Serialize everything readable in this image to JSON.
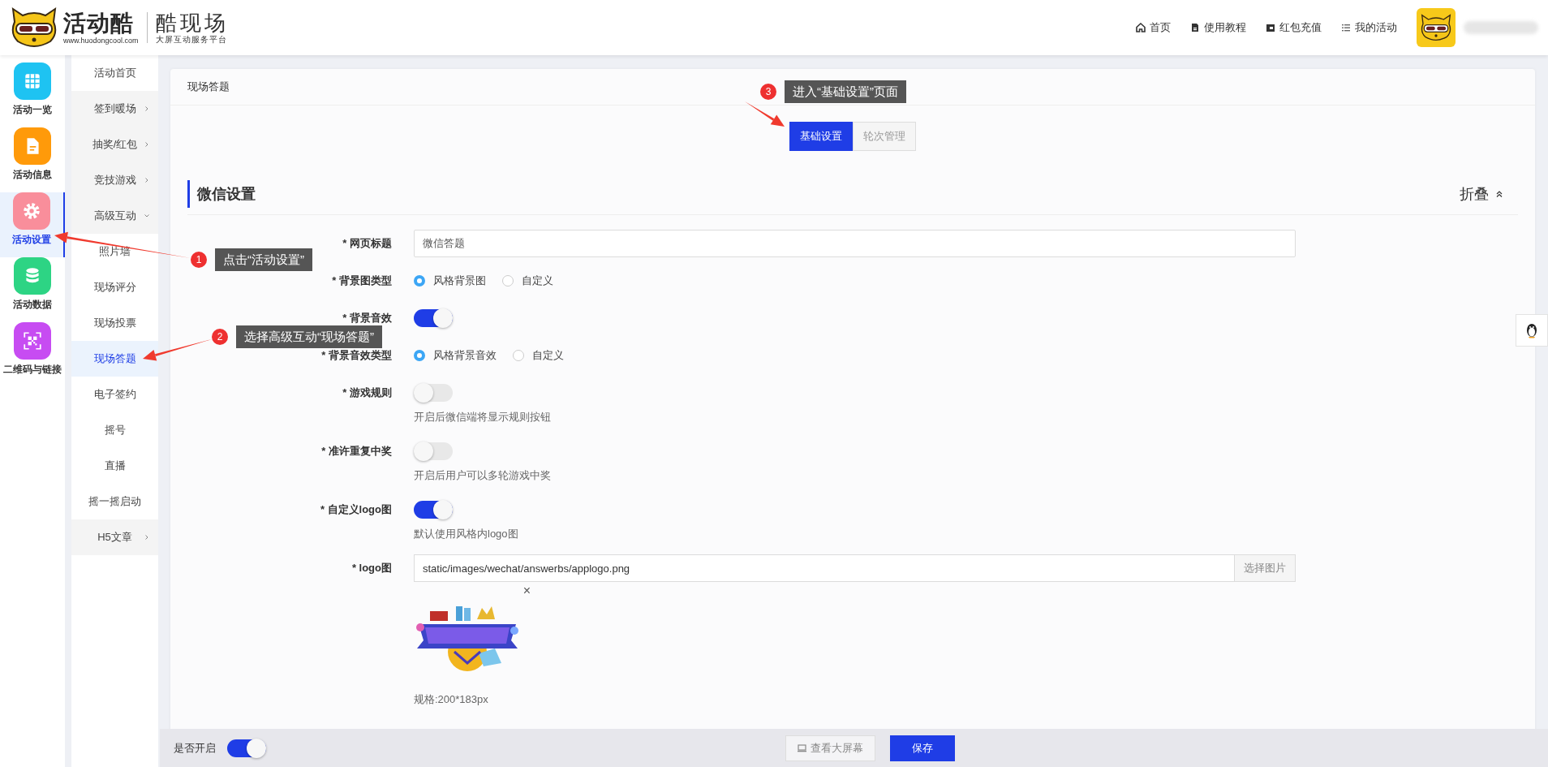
{
  "header": {
    "logo": {
      "brand": "活动酷",
      "url": "www.huodongcool.com",
      "product": "酷现场",
      "slogan": "大屏互动服务平台"
    },
    "nav": [
      {
        "label": "首页"
      },
      {
        "label": "使用教程"
      },
      {
        "label": "红包充值"
      },
      {
        "label": "我的活动"
      }
    ]
  },
  "modules": [
    {
      "label": "活动一览",
      "color": "#1ec3f2",
      "selected": false
    },
    {
      "label": "活动信息",
      "color": "#ff9a0a",
      "selected": false
    },
    {
      "label": "活动设置",
      "color": "#f98e9b",
      "selected": true
    },
    {
      "label": "活动数据",
      "color": "#2dd484",
      "selected": false
    },
    {
      "label": "二维码与链接",
      "color": "#c74cf2",
      "selected": false
    }
  ],
  "menu": [
    {
      "label": "活动首页",
      "kind": "link",
      "selected": false
    },
    {
      "label": "签到暖场",
      "kind": "group",
      "expanded": false
    },
    {
      "label": "抽奖/红包",
      "kind": "group",
      "expanded": false
    },
    {
      "label": "竞技游戏",
      "kind": "group",
      "expanded": false
    },
    {
      "label": "高级互动",
      "kind": "group",
      "expanded": true,
      "children": [
        {
          "label": "照片墙",
          "selected": false
        },
        {
          "label": "现场评分",
          "selected": false
        },
        {
          "label": "现场投票",
          "selected": false
        },
        {
          "label": "现场答题",
          "selected": true
        },
        {
          "label": "电子签约",
          "selected": false
        },
        {
          "label": "摇号",
          "selected": false
        },
        {
          "label": "直播",
          "selected": false
        },
        {
          "label": "摇一摇启动",
          "selected": false
        }
      ]
    },
    {
      "label": "H5文章",
      "kind": "group",
      "expanded": false
    }
  ],
  "page": {
    "title": "现场答题",
    "tabs": [
      {
        "label": "基础设置",
        "selected": true
      },
      {
        "label": "轮次管理",
        "selected": false
      }
    ],
    "section": {
      "title": "微信设置",
      "collapse": "折叠",
      "fields": [
        {
          "label": "* 网页标题",
          "kind": "input",
          "value": "微信答题"
        },
        {
          "label": "* 背景图类型",
          "kind": "radio",
          "options": [
            {
              "label": "风格背景图",
              "selected": true
            },
            {
              "label": "自定义",
              "selected": false
            }
          ]
        },
        {
          "label": "* 背景音效",
          "kind": "switch",
          "on": true
        },
        {
          "label": "* 背景音效类型",
          "kind": "radio",
          "options": [
            {
              "label": "风格背景音效",
              "selected": true
            },
            {
              "label": "自定义",
              "selected": false
            }
          ]
        },
        {
          "label": "* 游戏规则",
          "kind": "switch",
          "on": false,
          "hint": "开启后微信端将显示规则按钮"
        },
        {
          "label": "* 准许重复中奖",
          "kind": "switch",
          "on": false,
          "hint": "开启后用户可以多轮游戏中奖"
        },
        {
          "label": "* 自定义logo图",
          "kind": "switch",
          "on": true,
          "hint": "默认使用风格内logo图"
        },
        {
          "label": "* logo图",
          "kind": "file",
          "value": "static/images/wechat/answerbs/applogo.png",
          "button": "选择图片",
          "remove": "×",
          "hint": "规格:200*183px"
        }
      ]
    }
  },
  "footer": {
    "enable_label": "是否开启",
    "enabled": true,
    "buttons": [
      {
        "label": "查看大屏幕",
        "kind": "preview"
      },
      {
        "label": "保存",
        "kind": "primary"
      }
    ]
  },
  "annotations": [
    {
      "number": "1",
      "text": "点击“活动设置”"
    },
    {
      "number": "2",
      "text": "选择高级互动“现场答题”"
    },
    {
      "number": "3",
      "text": "进入“基础设置”页面"
    }
  ]
}
